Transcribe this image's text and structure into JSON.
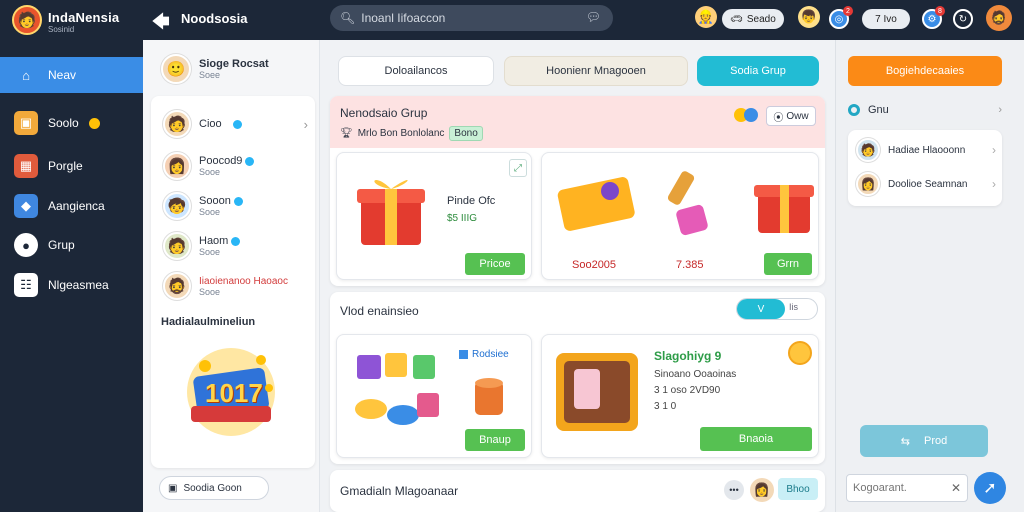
{
  "app": {
    "name": "IndaNensia",
    "subtitle": "Sosinid"
  },
  "header": {
    "back_icon": "arrow-left-icon",
    "title": "Noodsosia",
    "search": {
      "placeholder": "Inoanl Iifoaccon"
    },
    "pill1": "Seado",
    "pill2": "7 Ivo",
    "notif_count": "2",
    "notif_count2": "8"
  },
  "nav": {
    "items": [
      {
        "label": "Neav",
        "icon": "home-icon",
        "active": true
      },
      {
        "label": "Soolo",
        "icon": "treasure-icon"
      },
      {
        "label": "Porgle",
        "icon": "blocks-icon"
      },
      {
        "label": "Aangienca",
        "icon": "cube-icon"
      },
      {
        "label": "Grup",
        "icon": "group-icon"
      },
      {
        "label": "Nlgeasmea",
        "icon": "grid-icon"
      }
    ]
  },
  "profile": {
    "name": "Sioge Rocsat",
    "sub": "Soee"
  },
  "friends": [
    {
      "name": "Cioo",
      "sub": ""
    },
    {
      "name": "Poocod9",
      "sub": "Sooe"
    },
    {
      "name": "Sooon",
      "sub": "Sooe"
    },
    {
      "name": "Haom",
      "sub": "Sooe"
    },
    {
      "name": "Iiaoienanoo Haoaoc",
      "sub": "Sooe"
    }
  ],
  "promo": {
    "title": "Hadialaulmineliun",
    "number": "1017"
  },
  "footer_btn": "Soodia Goon",
  "tabs": [
    "Doloailancos",
    "Hoonienr Mnagooen",
    "Sodia Grup"
  ],
  "group": {
    "title": "Nenodsaio Grup",
    "meta": "Mrlo Bon Bonlolanc",
    "tag": "Bono",
    "own_label": "Oww",
    "product1": {
      "title": "Pinde Ofc",
      "sub": "$5 IIIG",
      "button": "Pricoe"
    },
    "product2": {
      "price_a": "Soo2005",
      "price_b": "7.385",
      "button": "Grrn"
    }
  },
  "section2": {
    "title": "Vlod enainsieo",
    "toggle": "V",
    "toggle_b": "Iis",
    "card1": {
      "label": "Rodsiee",
      "button": "Bnaup"
    },
    "card2": {
      "title": "Slagohiyg 9",
      "line1": "Sinoano Ooaoinas",
      "line2": "3 1 oso 2VD90",
      "line3": "3 1 0",
      "button": "Bnaoia"
    }
  },
  "section3": {
    "title": "Gmadialn Mlagoanaar",
    "badge": "Bhoo"
  },
  "right": {
    "orange_btn": "Bogiehdecaaies",
    "group_label": "Gnu",
    "members": [
      {
        "name": "Hadiae Hlaooonn"
      },
      {
        "name": "Doolioe Seamnan"
      }
    ],
    "prod_btn": "Prod",
    "input": {
      "placeholder": "Kogoarant."
    }
  },
  "colors": {
    "topbar": "#1c2738",
    "nav_active": "#3a8de6",
    "accent_cyan": "#22bcd4",
    "accent_orange": "#fb8a16",
    "accent_green": "#56c152",
    "group_header_bg": "#fde2e2"
  }
}
